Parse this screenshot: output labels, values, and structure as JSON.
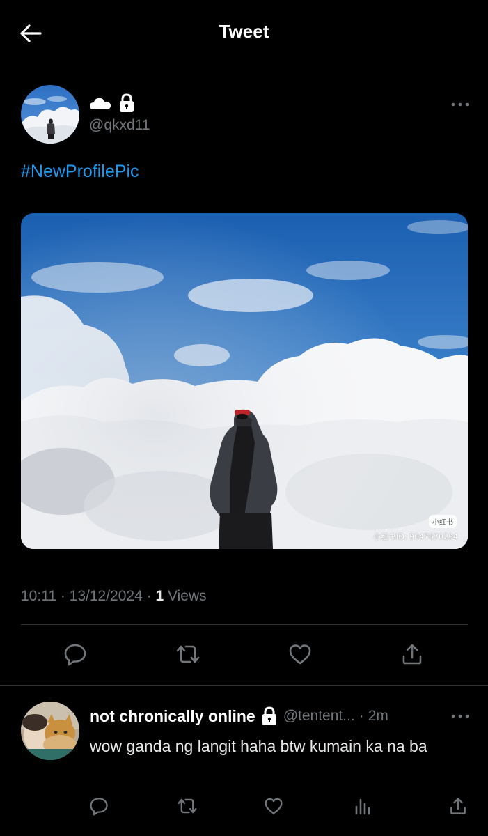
{
  "header": {
    "title": "Tweet",
    "back_icon": "arrow-left-icon"
  },
  "tweet": {
    "author": {
      "display_icons": [
        "cloud-icon",
        "lock-icon"
      ],
      "handle": "@qkxd11"
    },
    "text": "#NewProfilePic",
    "media": {
      "watermark_badge": "小红书",
      "watermark_id": "小红书ID: 9047670294"
    },
    "meta": {
      "time": "10:11",
      "sep1": " · ",
      "date": "13/12/2024",
      "sep2": " · ",
      "views_count": "1",
      "views_label": " Views"
    },
    "actions": [
      "reply-icon",
      "retweet-icon",
      "like-icon",
      "share-icon"
    ]
  },
  "reply": {
    "name": "not chronically online",
    "handle": "@tentent...",
    "separator": "·",
    "time": "2m",
    "text": "wow ganda ng langit haha btw kumain ka na ba",
    "actions": [
      "reply-icon",
      "retweet-icon",
      "like-icon",
      "analytics-icon",
      "share-icon"
    ]
  },
  "colors": {
    "background": "#000000",
    "accent": "#1d9bf0",
    "muted": "#71767b",
    "divider": "#2f3336"
  }
}
